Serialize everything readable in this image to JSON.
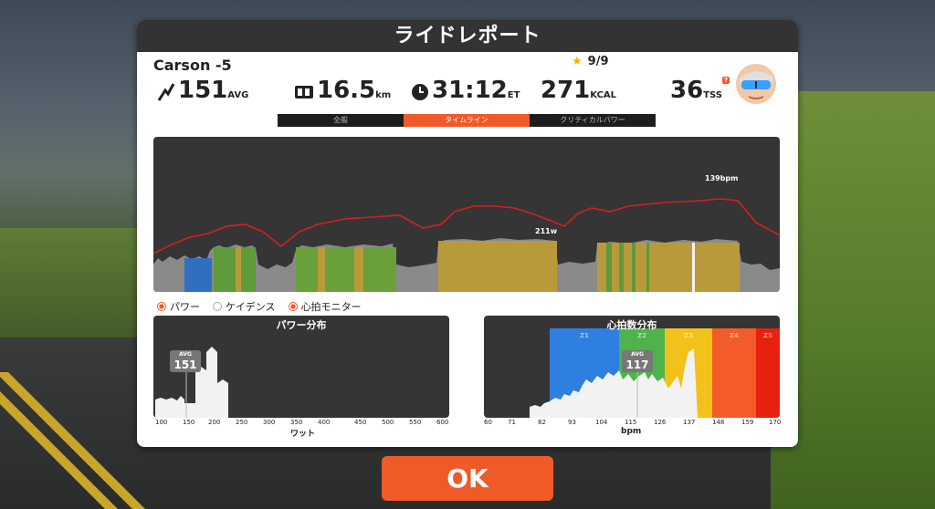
{
  "dialog": {
    "title": "ライドレポート",
    "rider_name": "Carson -5",
    "stars": "9/9"
  },
  "stats": {
    "power": {
      "value": "151",
      "unit": "AVG",
      "icon": "power-bolt-icon"
    },
    "distance": {
      "value": "16.5",
      "unit": "km",
      "icon": "odometer-icon"
    },
    "time": {
      "value": "31:12",
      "unit": "ET",
      "icon": "clock-icon"
    },
    "calories": {
      "value": "271",
      "unit": "KCAL"
    },
    "tss": {
      "value": "36",
      "unit": "TSS",
      "badge": "?"
    }
  },
  "tabs": [
    "全般",
    "タイムライン",
    "クリティカルパワー"
  ],
  "active_tab": 1,
  "timeline": {
    "hr_peak_label": "139bpm",
    "power_peak_label": "211w"
  },
  "legend": [
    "パワー",
    "ケイデンス",
    "心拍モニター"
  ],
  "power_dist": {
    "title": "パワー分布",
    "avg_label": "AVG",
    "avg_value": "151",
    "xticks": [
      "100",
      "150",
      "200",
      "250",
      "300",
      "350",
      "400",
      "450",
      "500",
      "550",
      "600"
    ],
    "xlabel": "ワット"
  },
  "hr_dist": {
    "title": "心拍数分布",
    "avg_label": "AVG",
    "avg_value": "117",
    "zones": [
      "Z1",
      "Z2",
      "Z3",
      "Z4",
      "Z5"
    ],
    "zone_colors": [
      "#2f7fe0",
      "#4db34a",
      "#f2c21b",
      "#f35b2b",
      "#e8200e"
    ],
    "xticks": [
      "60",
      "71",
      "82",
      "93",
      "104",
      "115",
      "126",
      "137",
      "148",
      "159",
      "170"
    ],
    "xlabel": "bpm"
  },
  "ok_label": "OK",
  "colors": {
    "accent": "#f05a28",
    "panel": "#353535",
    "hr_line": "#d42020"
  }
}
